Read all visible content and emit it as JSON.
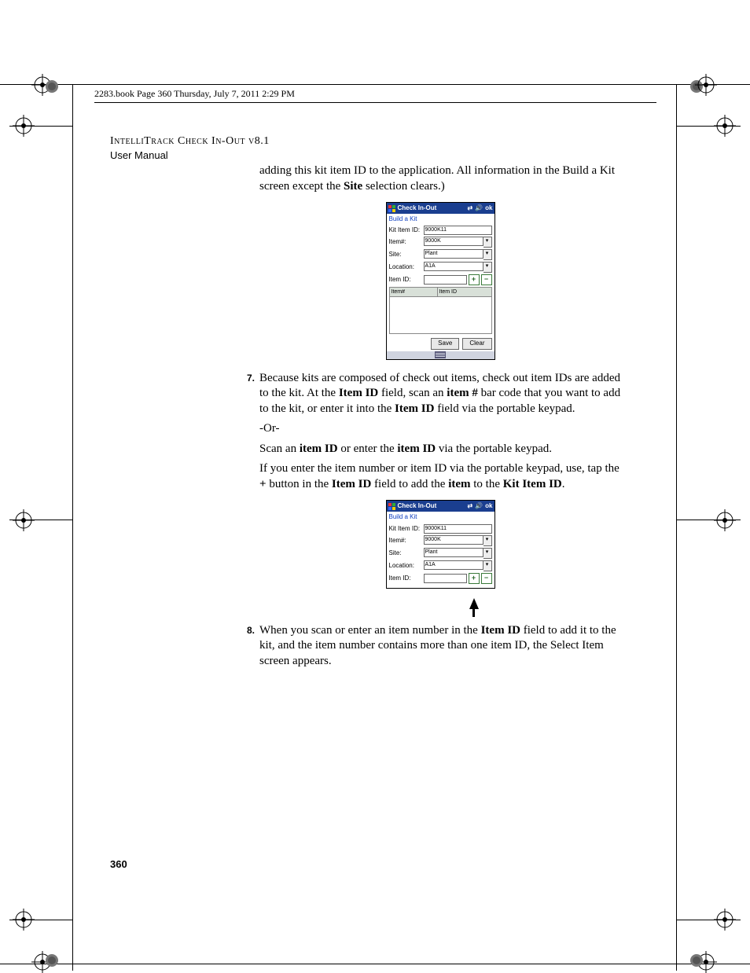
{
  "header_line": "2283.book  Page 360  Thursday, July 7, 2011  2:29 PM",
  "product_title": "IntelliTrack Check In-Out v8.1",
  "product_sub": "User Manual",
  "page_number": "360",
  "para_intro_pre": "adding this kit item ID to the application. All information in the Build a Kit screen except the ",
  "para_intro_bold": "Site",
  "para_intro_post": " selection clears.)",
  "step7_num": "7.",
  "step7": {
    "t1": "Because kits are composed of check out items, check out item IDs are added to the kit. At the ",
    "b1": "Item ID",
    "t2": " field, scan an ",
    "b2": "item #",
    "t3": " bar code that you want to add to the kit, or enter it into the ",
    "b3": "Item ID",
    "t4": " field via the portable keypad."
  },
  "or_text": "-Or-",
  "scan_line": {
    "t1": "Scan an ",
    "b1": "item ID",
    "t2": " or enter the ",
    "b2": "item ID",
    "t3": " via the portable keypad."
  },
  "enter_line": {
    "t1": "If you enter the item number or item ID via the portable keypad, use, tap the ",
    "b1": "+",
    "t2": " button in the ",
    "b2": "Item ID",
    "t3": " field to add the ",
    "b3": "item",
    "t4": " to the ",
    "b4": "Kit Item ID",
    "t5": "."
  },
  "step8_num": "8.",
  "step8": {
    "t1": "When you scan or enter an item number in the ",
    "b1": "Item ID",
    "t2": " field to add it to the kit, and the item number contains more than one item ID, the Select Item screen appears."
  },
  "app": {
    "title": "Check In-Out",
    "tb_ok": "ok",
    "subtitle": "Build a Kit",
    "labels": {
      "kit_item_id": "Kit Item ID:",
      "item_num": "Item#:",
      "site": "Site:",
      "location": "Location:",
      "item_id": "Item ID:"
    },
    "values": {
      "kit_item_id": "9000K11",
      "item_num": "9000K",
      "site": "Plant",
      "location": "A1A",
      "item_id": ""
    },
    "plus": "+",
    "minus": "−",
    "col_item_num": "Item#",
    "col_item_id": "Item ID",
    "btn_save": "Save",
    "btn_clear": "Clear"
  }
}
